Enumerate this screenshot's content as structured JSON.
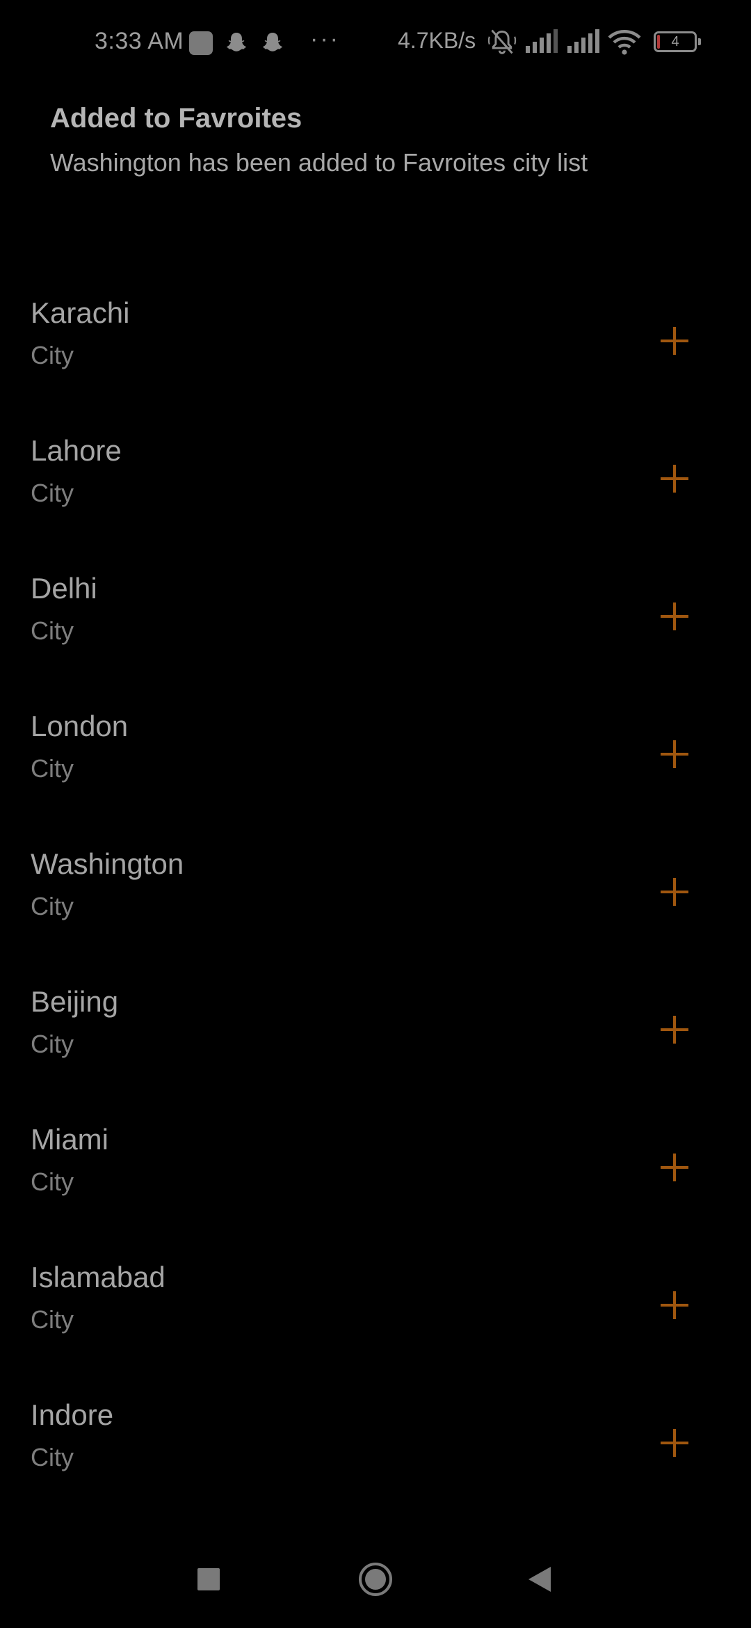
{
  "status_bar": {
    "time": "3:33 AM",
    "network_speed": "4.7KB/s",
    "battery_level": "4",
    "icons": [
      "app-square-icon",
      "snapchat-icon",
      "snapchat-icon",
      "more-dots-icon",
      "muted-bell-icon",
      "signal-icon",
      "signal-icon",
      "wifi-icon",
      "battery-icon"
    ],
    "more_dots": "···"
  },
  "toast": {
    "title": "Added to Favroites",
    "message": "Washington has been added to Favroites city list"
  },
  "cities": [
    {
      "name": "Karachi",
      "type": "City"
    },
    {
      "name": "Lahore",
      "type": "City"
    },
    {
      "name": "Delhi",
      "type": "City"
    },
    {
      "name": "London",
      "type": "City"
    },
    {
      "name": "Washington",
      "type": "City"
    },
    {
      "name": "Beijing",
      "type": "City"
    },
    {
      "name": "Miami",
      "type": "City"
    },
    {
      "name": "Islamabad",
      "type": "City"
    },
    {
      "name": "Indore",
      "type": "City"
    }
  ],
  "colors": {
    "accent": "#a0570f",
    "background": "#000000",
    "primary_text": "#a5a5a5",
    "secondary_text": "#7e7e7e"
  },
  "nav_bar": {
    "icons": [
      "recents-square-icon",
      "home-circle-icon",
      "back-triangle-icon"
    ]
  }
}
